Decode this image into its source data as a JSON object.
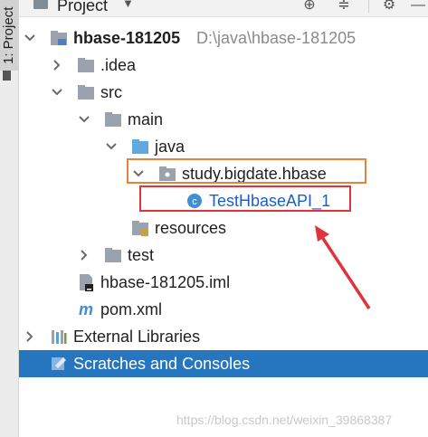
{
  "sidebar": {
    "tab_label": "1: Project"
  },
  "header": {
    "title": "Project"
  },
  "tree": {
    "root_name": "hbase-181205",
    "root_path": "D:\\java\\hbase-181205",
    "idea": ".idea",
    "src": "src",
    "main": "main",
    "java": "java",
    "package": "study.bigdate.hbase",
    "class_file": "TestHbaseAPI_1",
    "resources": "resources",
    "test": "test",
    "iml": "hbase-181205.iml",
    "pom": "pom.xml",
    "external_libraries": "External Libraries",
    "scratches": "Scratches and Consoles"
  },
  "watermark": "https://blog.csdn.net/weixin_39868387",
  "colors": {
    "selection": "#2675bf",
    "folder": "#9aa3ad",
    "source_folder": "#5fa9e0",
    "file_link": "#1a5fc6",
    "orange_highlight": "#e8823a",
    "red_highlight": "#e0333b"
  }
}
